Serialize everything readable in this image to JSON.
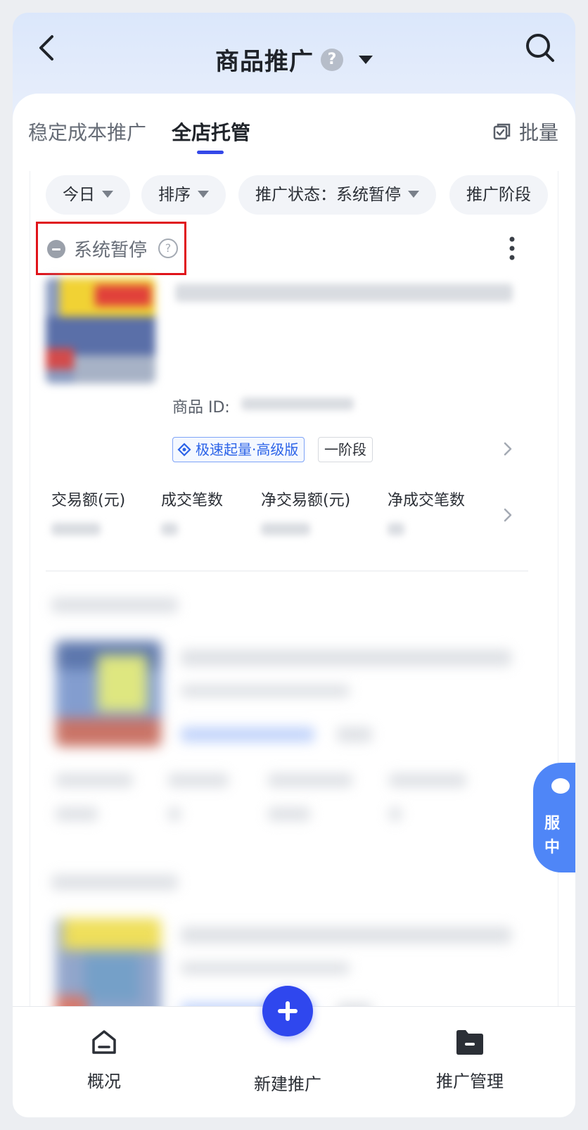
{
  "header": {
    "title": "商品推广",
    "help_icon": "?"
  },
  "tabs": [
    {
      "label": "稳定成本推广",
      "active": false
    },
    {
      "label": "全店托管",
      "active": true
    }
  ],
  "batch_label": "批量",
  "filters": [
    {
      "label": "今日"
    },
    {
      "label": "排序"
    },
    {
      "label": "推广状态：系统暂停"
    },
    {
      "label": "推广阶段"
    }
  ],
  "product": {
    "status": "系统暂停",
    "status_help": "?",
    "id_label": "商品 ID:",
    "tag_primary": "极速起量·高级版",
    "tag_stage": "一阶段",
    "metrics": [
      "交易额(元)",
      "成交笔数",
      "净交易额(元)",
      "净成交笔数"
    ]
  },
  "service_float": {
    "line1": "服",
    "line2": "中"
  },
  "bottom_nav": {
    "overview": "概况",
    "new_promo": "新建推广",
    "manage": "推广管理"
  },
  "colors": {
    "accent": "#3448e8",
    "status_highlight": "#e0131a",
    "tag_blue": "#2b63e8"
  }
}
